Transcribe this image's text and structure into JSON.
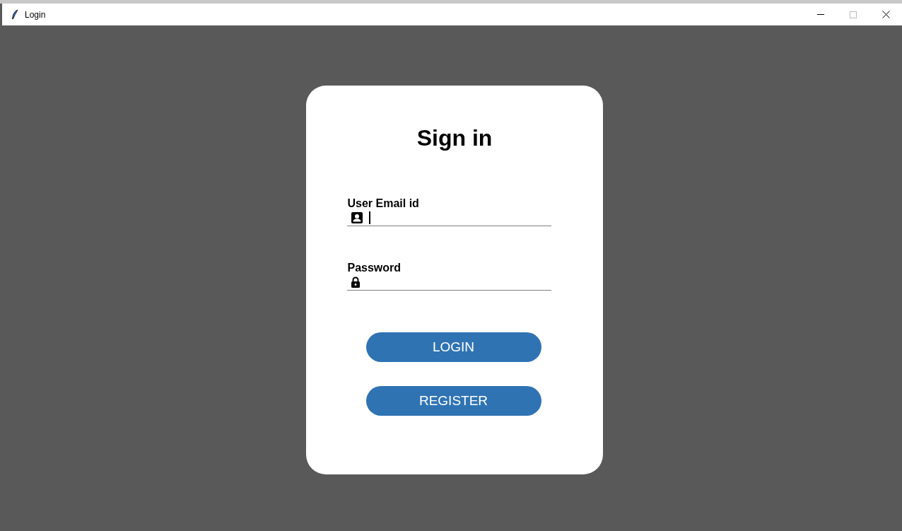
{
  "window": {
    "title": "Login"
  },
  "card": {
    "heading": "Sign in",
    "fields": [
      {
        "label": "User Email id",
        "kind": "email",
        "focused": true
      },
      {
        "label": "Password",
        "kind": "password",
        "focused": false
      }
    ],
    "buttons": [
      "LOGIN",
      "REGISTER"
    ]
  }
}
